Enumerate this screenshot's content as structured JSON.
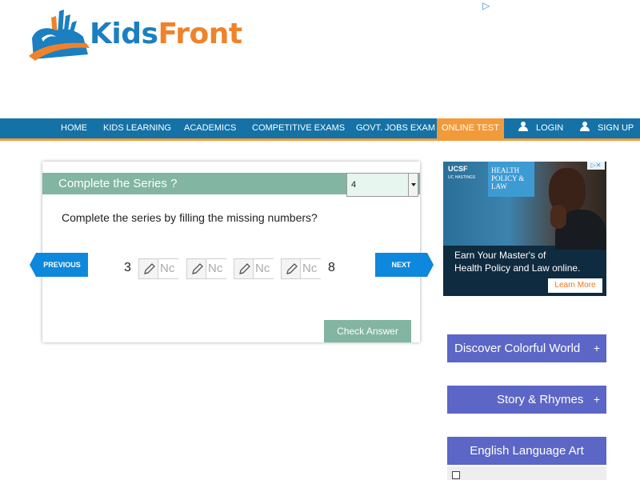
{
  "header": {
    "logo": {
      "part1": "Kids",
      "part2": "Front",
      "icon": "kidsfront-logo-icon"
    },
    "ad_choice_icon": "adchoices-icon"
  },
  "nav": {
    "items": [
      {
        "label": "HOME"
      },
      {
        "label": "KIDS LEARNING"
      },
      {
        "label": "ACADEMICS"
      },
      {
        "label": "COMPETITIVE EXAMS"
      },
      {
        "label": "GOVT. JOBS EXAM"
      },
      {
        "label": "ONLINE TEST",
        "active": true
      },
      {
        "label": "LOGIN",
        "icon": "user-icon"
      },
      {
        "label": "SIGN UP",
        "icon": "user-icon"
      }
    ]
  },
  "quiz": {
    "title": "Complete the Series ?",
    "select_value": "4",
    "question": "Complete the series by filling the missing numbers?",
    "prev_label": "PREVIOUS",
    "next_label": "NEXT",
    "start_number": "3",
    "end_number": "8",
    "blank_placeholder": "Nc",
    "blank_icon": "pencil-icon",
    "check_label": "Check Answer"
  },
  "ad": {
    "brand": "UCSF",
    "brand_sub": "UC HASTINGS",
    "program": [
      "HEALTH",
      "POLICY &",
      "LAW"
    ],
    "line1": "Earn Your Master's of",
    "line2": "Health Policy and Law online.",
    "cta": "Learn More",
    "close_icon": "ad-close-icon"
  },
  "sidebar": {
    "items": [
      {
        "label": "Discover Colorful World",
        "plus": "+"
      },
      {
        "label": "Story & Rhymes",
        "plus": "+"
      },
      {
        "label": "English Language Art"
      }
    ]
  },
  "colors": {
    "nav_bg": "#1572a6",
    "nav_accent": "#f29a3a",
    "quiz_green": "#82b5a2",
    "arrow_blue": "#0e88dc",
    "sidebar_purple": "#5c66c6"
  }
}
